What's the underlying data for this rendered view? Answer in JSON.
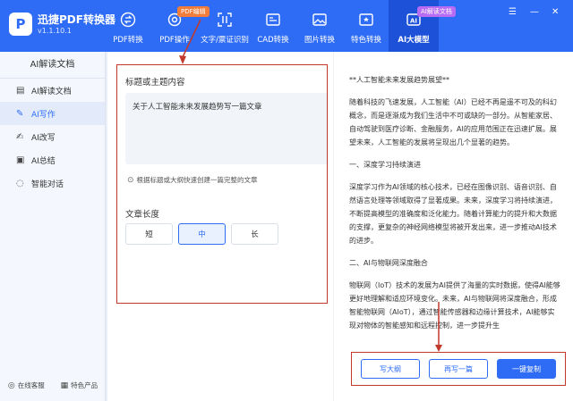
{
  "app": {
    "logo_letter": "P",
    "name": "迅捷PDF转换器",
    "version": "v1.1.10.1"
  },
  "nav": [
    {
      "label": "PDF转换",
      "icon": "convert-icon"
    },
    {
      "label": "PDF操作",
      "icon": "gear-icon",
      "tag": "PDF编辑"
    },
    {
      "label": "文字/票证识别",
      "icon": "scan-icon"
    },
    {
      "label": "CAD转换",
      "icon": "cad-icon"
    },
    {
      "label": "图片转换",
      "icon": "image-icon"
    },
    {
      "label": "特色转换",
      "icon": "star-icon"
    },
    {
      "label": "AI大模型",
      "icon": "ai-icon",
      "tag": "AI解读文档",
      "active": true
    }
  ],
  "window": {
    "menu": "☰",
    "min": "—",
    "close": "✕"
  },
  "sidebar": {
    "title": "AI解读文档",
    "items": [
      {
        "label": "AI解读文档",
        "icon": "document-icon"
      },
      {
        "label": "AI写作",
        "icon": "pen-icon",
        "active": true
      },
      {
        "label": "AI改写",
        "icon": "rewrite-icon"
      },
      {
        "label": "AI总结",
        "icon": "summary-icon"
      },
      {
        "label": "智能对话",
        "icon": "chat-icon"
      }
    ],
    "footer": [
      {
        "label": "在线客服",
        "icon": "headset-icon"
      },
      {
        "label": "特色产品",
        "icon": "grid-icon"
      }
    ]
  },
  "form": {
    "title_label": "标题或主题内容",
    "input_value": "关于人工智能未来发展趋势写一篇文章",
    "tip": "根据标题或大纲快速创建一篇完整的文章",
    "length_label": "文章长度",
    "lengths": [
      "短",
      "中",
      "长"
    ],
    "selected_length": "中"
  },
  "article": [
    "**人工智能未来发展趋势展望**",
    "随着科技的飞速发展，人工智能（AI）已经不再是遥不可及的科幻概念，而是逐渐成为我们生活中不可或缺的一部分。从智能家居、自动驾驶到医疗诊断、金融服务，AI的应用范围正在迅速扩展。展望未来，人工智能的发展将呈现出几个显著的趋势。",
    "一、深度学习持续演进",
    "深度学习作为AI领域的核心技术，已经在图像识别、语音识别、自然语言处理等领域取得了显著成果。未来，深度学习将持续演进，不断提高模型的准确度和泛化能力。随着计算能力的提升和大数据的支撑，更复杂的神经网络模型将被开发出来，进一步推动AI技术的进步。",
    "二、AI与物联网深度融合",
    "物联网（IoT）技术的发展为AI提供了海量的实时数据，使得AI能够更好地理解和适应环境变化。未来，AI与物联网将深度融合，形成智能物联网（AIoT），通过智能传感器和边缘计算技术，AI能够实现对物体的智能感知和远程控制，进一步提升生"
  ],
  "actions": {
    "outline": "写大纲",
    "rewrite": "再写一篇",
    "copy": "一键复制"
  },
  "colors": {
    "brand": "#2f6cf6",
    "highlight": "#c0392b",
    "tag_orange": "#f27d3b",
    "tag_purple": "#b86cf3"
  }
}
